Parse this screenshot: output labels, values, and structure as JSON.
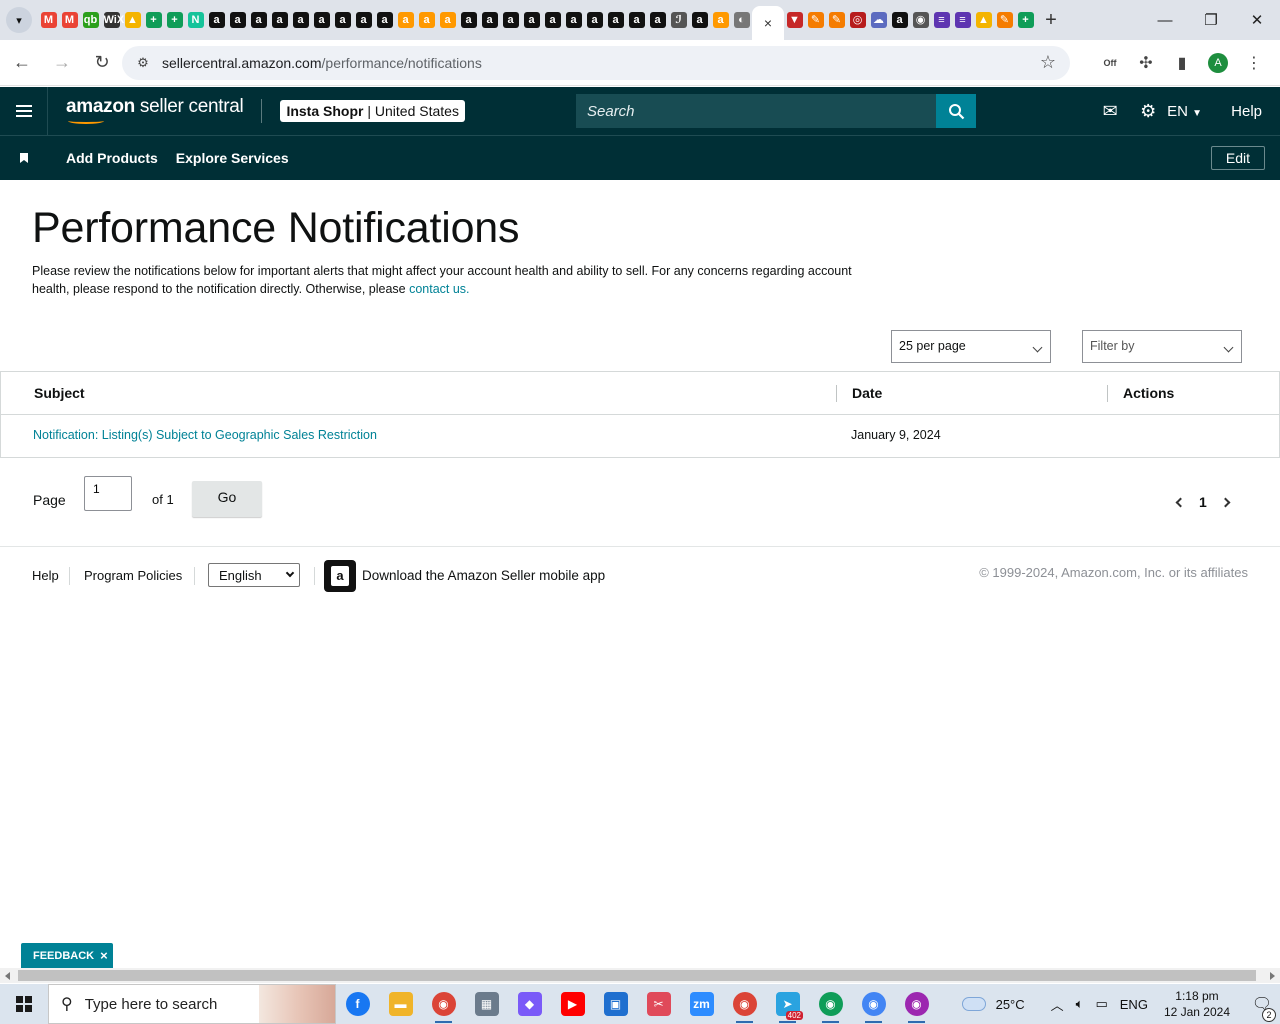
{
  "browser": {
    "active_tab_close": "×",
    "new_tab": "+",
    "url_host": "sellercentral.amazon.com",
    "url_path": "/performance/notifications",
    "profile_initial": "A",
    "extension_badge": "Off",
    "tab_favicons": [
      {
        "icon": "gmail-icon",
        "letter": "M",
        "color": "#ea4335"
      },
      {
        "icon": "gmail-icon",
        "letter": "M",
        "color": "#ea4335"
      },
      {
        "icon": "quickbooks-icon",
        "letter": "qb",
        "color": "#2ca01c"
      },
      {
        "icon": "wix-icon",
        "letter": "WiX",
        "color": "#333333"
      },
      {
        "icon": "google-drive-icon",
        "letter": "▲",
        "color": "#f4b400"
      },
      {
        "icon": "google-sheets-icon",
        "letter": "+",
        "color": "#0f9d58"
      },
      {
        "icon": "google-sheets-icon",
        "letter": "+",
        "color": "#0f9d58"
      },
      {
        "icon": "grammarly-icon",
        "letter": "N",
        "color": "#15c39a"
      },
      {
        "icon": "amazon-icon",
        "letter": "a",
        "color": "#111111"
      },
      {
        "icon": "amazon-icon",
        "letter": "a",
        "color": "#111111"
      },
      {
        "icon": "amazon-icon",
        "letter": "a",
        "color": "#111111"
      },
      {
        "icon": "amazon-icon",
        "letter": "a",
        "color": "#111111"
      },
      {
        "icon": "amazon-icon",
        "letter": "a",
        "color": "#111111"
      },
      {
        "icon": "amazon-icon",
        "letter": "a",
        "color": "#111111"
      },
      {
        "icon": "amazon-icon",
        "letter": "a",
        "color": "#111111"
      },
      {
        "icon": "amazon-icon",
        "letter": "a",
        "color": "#111111"
      },
      {
        "icon": "amazon-icon",
        "letter": "a",
        "color": "#111111"
      },
      {
        "icon": "amazon-smile-icon",
        "letter": "a",
        "color": "#ff9900"
      },
      {
        "icon": "amazon-smile-icon",
        "letter": "a",
        "color": "#ff9900"
      },
      {
        "icon": "amazon-smile-icon",
        "letter": "a",
        "color": "#ff9900"
      },
      {
        "icon": "amazon-icon",
        "letter": "a",
        "color": "#111111"
      },
      {
        "icon": "amazon-icon",
        "letter": "a",
        "color": "#111111"
      },
      {
        "icon": "amazon-icon",
        "letter": "a",
        "color": "#111111"
      },
      {
        "icon": "amazon-icon",
        "letter": "a",
        "color": "#111111"
      },
      {
        "icon": "amazon-icon",
        "letter": "a",
        "color": "#111111"
      },
      {
        "icon": "amazon-icon",
        "letter": "a",
        "color": "#111111"
      },
      {
        "icon": "amazon-icon",
        "letter": "a",
        "color": "#111111"
      },
      {
        "icon": "amazon-icon",
        "letter": "a",
        "color": "#111111"
      },
      {
        "icon": "amazon-icon",
        "letter": "a",
        "color": "#111111"
      },
      {
        "icon": "amazon-icon",
        "letter": "a",
        "color": "#111111"
      },
      {
        "icon": "scribble-icon",
        "letter": "ℐ",
        "color": "#555555"
      },
      {
        "icon": "amazon-icon",
        "letter": "a",
        "color": "#111111"
      },
      {
        "icon": "amazon-smile-icon",
        "letter": "a",
        "color": "#ff9900"
      },
      {
        "icon": "globe-icon",
        "letter": "◐",
        "color": "#777777"
      }
    ],
    "tab_favicons_after": [
      {
        "icon": "triangle-flag-icon",
        "letter": "▼",
        "color": "#c62828"
      },
      {
        "icon": "pencil-icon",
        "letter": "✎",
        "color": "#f57c00"
      },
      {
        "icon": "pencil-icon",
        "letter": "✎",
        "color": "#f57c00"
      },
      {
        "icon": "circle-badge-icon",
        "letter": "◎",
        "color": "#b71c1c"
      },
      {
        "icon": "cloud-badge-icon",
        "letter": "☁",
        "color": "#5c6bc0"
      },
      {
        "icon": "amazon-icon",
        "letter": "a",
        "color": "#111111"
      },
      {
        "icon": "chrome-icon",
        "letter": "◉",
        "color": "#555555"
      },
      {
        "icon": "list-icon",
        "letter": "≡",
        "color": "#5e35b1"
      },
      {
        "icon": "list-icon",
        "letter": "≡",
        "color": "#5e35b1"
      },
      {
        "icon": "google-drive-icon",
        "letter": "▲",
        "color": "#f4b400"
      },
      {
        "icon": "pencil-icon",
        "letter": "✎",
        "color": "#f57c00"
      },
      {
        "icon": "google-sheets-icon",
        "letter": "+",
        "color": "#0f9d58"
      }
    ]
  },
  "header": {
    "logo_amazon": "amazon",
    "logo_rest": " seller central",
    "store_name": "Insta Shopr",
    "store_sep": " | ",
    "store_region": "United States",
    "search_placeholder": "Search",
    "language": "EN",
    "help": "Help"
  },
  "subnav": {
    "links": [
      "Add Products",
      "Explore Services"
    ],
    "edit": "Edit"
  },
  "main": {
    "title": "Performance Notifications",
    "description": "Please review the notifications below for important alerts that might affect your account health and ability to sell. For any concerns regarding account health, please respond to the notification directly. Otherwise, please ",
    "contact_link": "contact us.",
    "per_page": "25 per page",
    "filter_by": "Filter by",
    "table": {
      "columns": [
        "Subject",
        "Date",
        "Actions"
      ],
      "rows": [
        {
          "subject": "Notification: Listing(s) Subject to Geographic Sales Restriction",
          "date": "January 9, 2024",
          "actions": ""
        }
      ]
    },
    "pager": {
      "page_label": "Page",
      "page_value": "1",
      "of_label": "of 1",
      "go": "Go",
      "current": "1"
    }
  },
  "footer": {
    "help": "Help",
    "program_policies": "Program Policies",
    "language": "English",
    "download_app": "Download the Amazon Seller mobile app",
    "copyright": "© 1999-2024, Amazon.com, Inc. or its affiliates"
  },
  "feedback": {
    "label": "FEEDBACK",
    "close": "×"
  },
  "taskbar": {
    "search_placeholder": "Type here to search",
    "apps": [
      {
        "icon": "facebook-icon",
        "letter": "f",
        "color": "#1877f2",
        "open": false
      },
      {
        "icon": "file-explorer-icon",
        "letter": "▬",
        "color": "#f0b429",
        "open": false
      },
      {
        "icon": "chrome-icon",
        "letter": "◉",
        "color": "#db4437",
        "open": true
      },
      {
        "icon": "calculator-icon",
        "letter": "▦",
        "color": "#6b7b8c",
        "open": false
      },
      {
        "icon": "copilot-icon",
        "letter": "◆",
        "color": "#7a5af8",
        "open": false
      },
      {
        "icon": "youtube-icon",
        "letter": "▶",
        "color": "#ff0000",
        "open": false
      },
      {
        "icon": "store-icon",
        "letter": "▣",
        "color": "#1f6fcf",
        "open": false
      },
      {
        "icon": "snipping-tool-icon",
        "letter": "✂",
        "color": "#e04a5a",
        "open": false
      },
      {
        "icon": "zoom-icon",
        "letter": "zm",
        "color": "#2d8cff",
        "open": false
      },
      {
        "icon": "chrome-profile-icon",
        "letter": "◉",
        "color": "#db4437",
        "open": true
      },
      {
        "icon": "telegram-icon",
        "letter": "➤",
        "color": "#2aa3e0",
        "open": true,
        "badge": "402"
      },
      {
        "icon": "chrome-profile-a-icon",
        "letter": "◉",
        "color": "#0f9d58",
        "open": true
      },
      {
        "icon": "chrome-profile-a-icon",
        "letter": "◉",
        "color": "#4285f4",
        "open": true
      },
      {
        "icon": "chrome-profile-c-icon",
        "letter": "◉",
        "color": "#9c27b0",
        "open": true
      }
    ],
    "temperature": "25°C",
    "lang": "ENG",
    "time": "1:18 pm",
    "date": "12 Jan 2024",
    "notification_count": "2"
  }
}
